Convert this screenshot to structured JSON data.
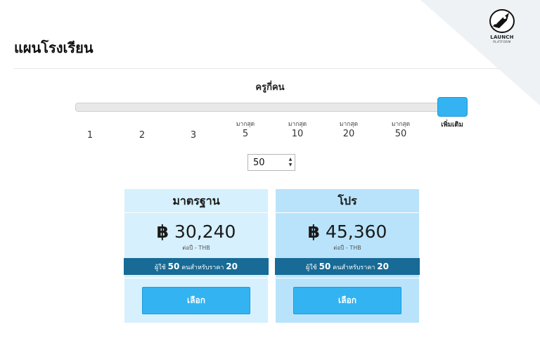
{
  "header": {
    "title": "แผนโรงเรียน"
  },
  "brand": {
    "name": "LAUNCH",
    "sub": "PLATFORM"
  },
  "slider": {
    "label": "ครูกี่คน",
    "selected_index": 7,
    "ticks": [
      {
        "prefix": "",
        "value": "1"
      },
      {
        "prefix": "",
        "value": "2"
      },
      {
        "prefix": "",
        "value": "3"
      },
      {
        "prefix": "มากสุด",
        "value": "5"
      },
      {
        "prefix": "มากสุด",
        "value": "10"
      },
      {
        "prefix": "มากสุด",
        "value": "20"
      },
      {
        "prefix": "มากสุด",
        "value": "50"
      },
      {
        "prefix": "",
        "value": "เพิ่มเติม"
      }
    ]
  },
  "stepper": {
    "value": "50"
  },
  "plans": [
    {
      "name": "มาตรฐาน",
      "currency": "฿",
      "price": "30,240",
      "period": "ต่อปี - THB",
      "band_prefix": "ผู้ใช้",
      "band_users": "50",
      "band_middle": "คนสำหรับราคา",
      "band_price": "20",
      "button": "เลือก"
    },
    {
      "name": "โปร",
      "currency": "฿",
      "price": "45,360",
      "period": "ต่อปี - THB",
      "band_prefix": "ผู้ใช้",
      "band_users": "50",
      "band_middle": "คนสำหรับราคา",
      "band_price": "20",
      "button": "เลือก"
    }
  ],
  "colors": {
    "accent": "#33b3f2",
    "band": "#176b96",
    "card_standard": "#d6f0fd",
    "card_pro": "#b9e3fb"
  }
}
